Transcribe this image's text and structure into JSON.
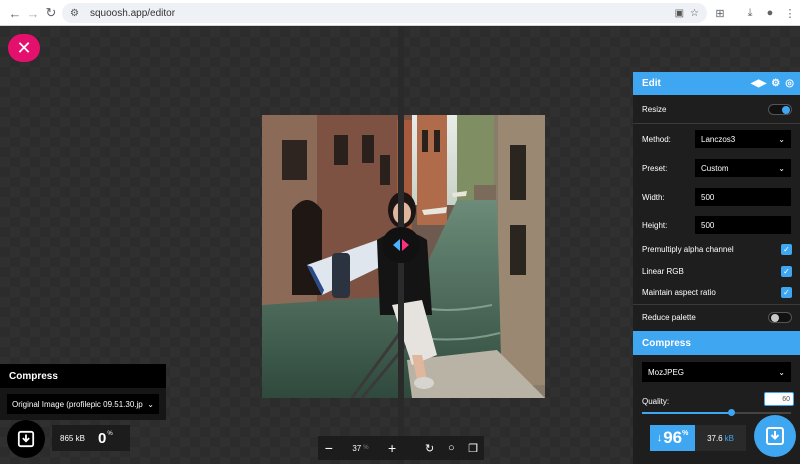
{
  "browser": {
    "url": "squoosh.app/editor"
  },
  "edit_panel": {
    "title": "Edit",
    "resize_label": "Resize",
    "resize_enabled": true,
    "method_label": "Method:",
    "method_value": "Lanczos3",
    "preset_label": "Preset:",
    "preset_value": "Custom",
    "width_label": "Width:",
    "width_value": "500",
    "height_label": "Height:",
    "height_value": "500",
    "premultiply_label": "Premultiply alpha channel",
    "premultiply_checked": true,
    "linear_rgb_label": "Linear RGB",
    "linear_rgb_checked": true,
    "aspect_label": "Maintain aspect ratio",
    "aspect_checked": true,
    "reduce_palette_label": "Reduce palette",
    "reduce_palette_enabled": false
  },
  "compress_right": {
    "title": "Compress",
    "codec": "MozJPEG",
    "quality_label": "Quality:",
    "quality_value": "60",
    "quality_fraction": 0.6,
    "savings_arrow": "↓",
    "savings_value": "96",
    "savings_unit": "%",
    "size_value": "37.6",
    "size_unit": "kB"
  },
  "compress_left": {
    "title": "Compress",
    "codec": "Original Image (profilepic 09.51.30.jp",
    "size_value": "865",
    "size_unit": "kB",
    "savings_value": "0",
    "savings_unit": "%"
  },
  "zoom": {
    "minus": "−",
    "value": "37",
    "unit": "%",
    "plus": "+"
  },
  "colors": {
    "accent": "#3fa6f2",
    "close": "#e5106e"
  }
}
